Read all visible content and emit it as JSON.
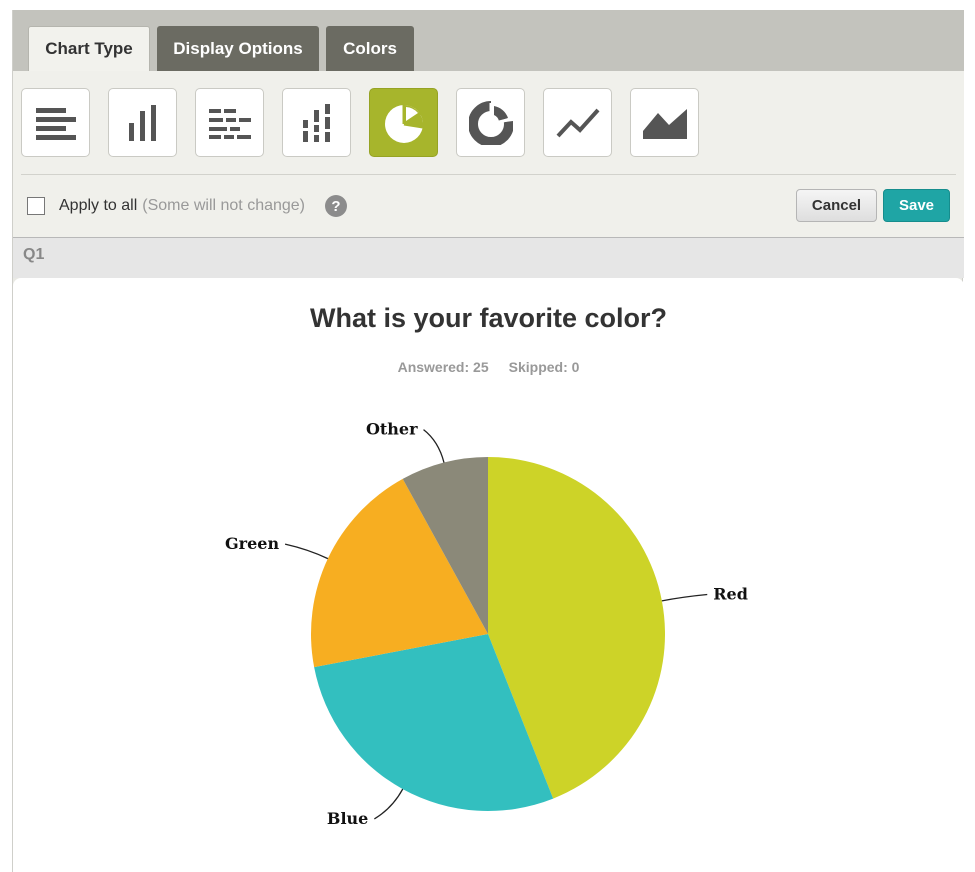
{
  "tabs": [
    {
      "label": "Chart Type",
      "active": true
    },
    {
      "label": "Display Options",
      "active": false
    },
    {
      "label": "Colors",
      "active": false
    }
  ],
  "chart_types": [
    {
      "name": "horizontal-bar",
      "selected": false
    },
    {
      "name": "vertical-bar",
      "selected": false
    },
    {
      "name": "stacked-horizontal-bar",
      "selected": false
    },
    {
      "name": "stacked-vertical-bar",
      "selected": false
    },
    {
      "name": "pie",
      "selected": true
    },
    {
      "name": "donut",
      "selected": false
    },
    {
      "name": "line",
      "selected": false
    },
    {
      "name": "area",
      "selected": false
    }
  ],
  "apply": {
    "label": "Apply to all",
    "hint": "(Some will not change)",
    "checked": false,
    "help_icon": "question-icon"
  },
  "buttons": {
    "cancel": "Cancel",
    "save": "Save"
  },
  "question": {
    "id": "Q1",
    "title": "What is your favorite color?",
    "answered": "Answered: 25",
    "skipped": "Skipped: 0"
  },
  "colors": {
    "selected_accent": "#a7b52c",
    "save_button": "#1fa5a5",
    "inactive_tab": "#6b6b62"
  },
  "chart_data": {
    "type": "pie",
    "title": "What is your favorite color?",
    "categories": [
      "Red",
      "Blue",
      "Green",
      "Other"
    ],
    "values": [
      44,
      28,
      20,
      8
    ],
    "unit": "percent",
    "colors": [
      "#cdd328",
      "#33bfbf",
      "#f7ae21",
      "#8b8979"
    ],
    "start_angle": "top, clockwise",
    "legend": "none (outside labels)"
  }
}
